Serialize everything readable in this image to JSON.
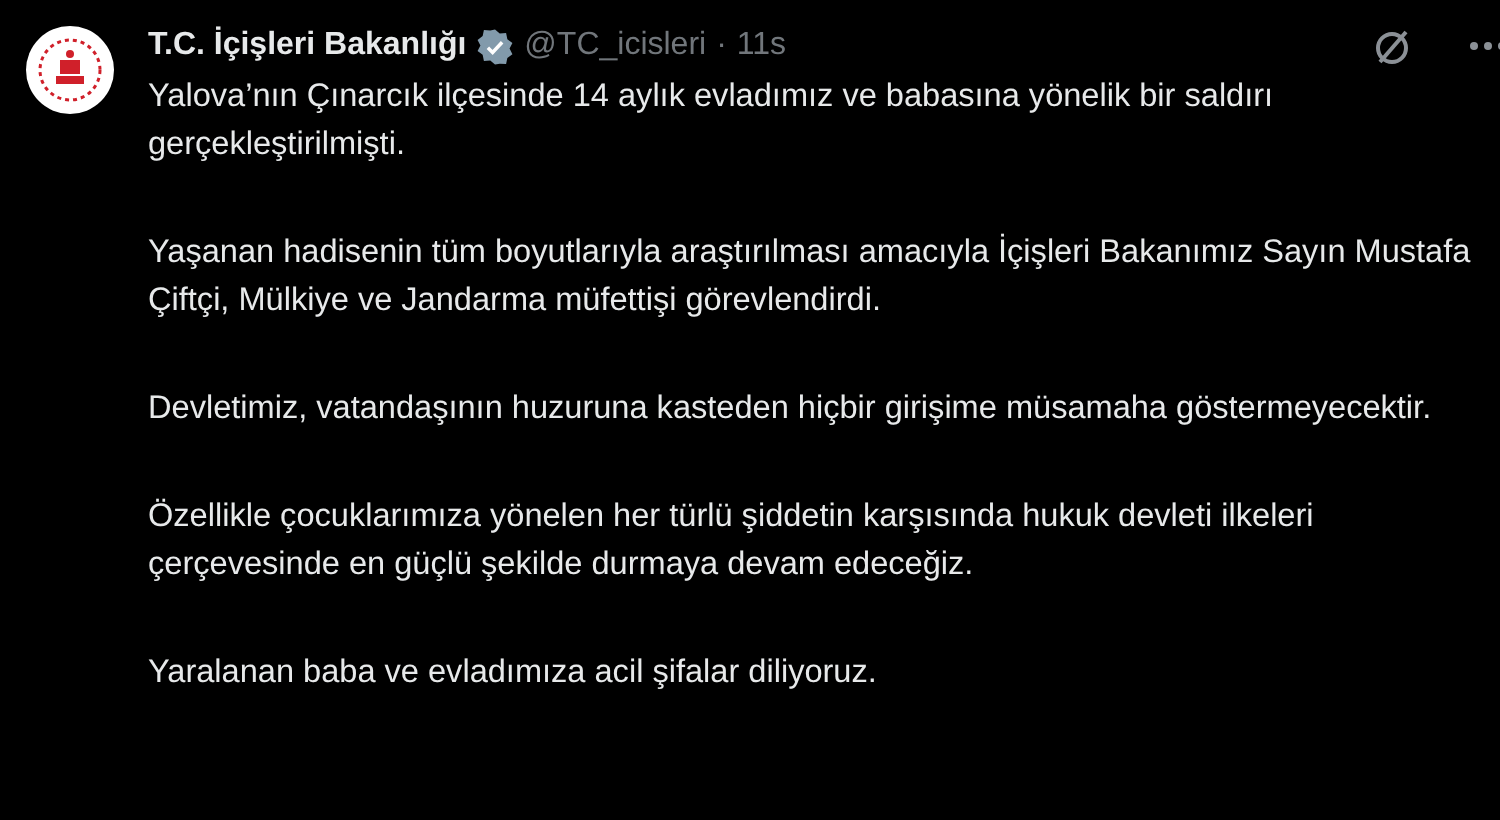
{
  "author": {
    "name": "T.C. İçişleri Bakanlığı",
    "verified": true,
    "handle": "@TC_icisleri",
    "separator": "·",
    "time": "11s"
  },
  "paragraphs": [
    "Yalova’nın Çınarcık ilçesinde 14 aylık evladımız ve babasına yönelik bir saldırı gerçekleştirilmişti.",
    "Yaşanan hadisenin tüm boyutlarıyla araştırılması amacıyla İçişleri Bakanımız Sayın Mustafa Çiftçi, Mülkiye ve Jandarma müfettişi görevlendirdi.",
    "Devletimiz, vatandaşının huzuruna kasteden hiçbir girişime müsamaha göstermeyecektir.",
    "Özellikle çocuklarımıza yönelen her türlü şiddetin karşısında hukuk devleti ilkeleri çerçevesinde en güçlü şekilde durmaya devam edeceğiz.",
    "Yaralanan baba ve evladımıza acil şifalar diliyoruz."
  ]
}
